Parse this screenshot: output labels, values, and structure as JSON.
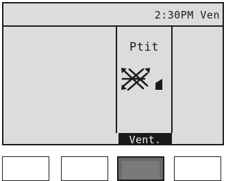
{
  "status": {
    "time": "2:30PM Ven"
  },
  "cell": {
    "label": "Ptit",
    "icon": "vane-swing-icon"
  },
  "tab": {
    "label": "Vent."
  },
  "softkeys": [
    {
      "name": "softkey-1",
      "active": false
    },
    {
      "name": "softkey-2",
      "active": false
    },
    {
      "name": "softkey-3",
      "active": true
    },
    {
      "name": "softkey-4",
      "active": false
    }
  ],
  "colors": {
    "screen_bg": "#dcdcdc",
    "ink": "#1a1a1a",
    "active_key": "#6a6a6a"
  }
}
